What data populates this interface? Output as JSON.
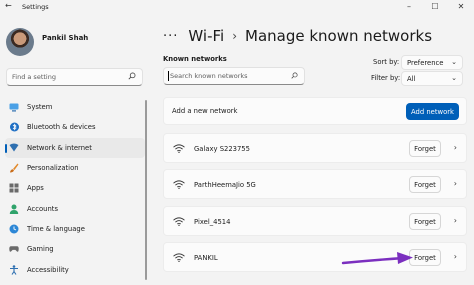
{
  "window": {
    "title": "Settings"
  },
  "user": {
    "name": "Pankil Shah"
  },
  "search": {
    "placeholder": "Find a setting"
  },
  "sidebar": {
    "items": [
      {
        "label": "System",
        "icon": "system-icon"
      },
      {
        "label": "Bluetooth & devices",
        "icon": "bluetooth-icon"
      },
      {
        "label": "Network & internet",
        "icon": "wifi-icon",
        "selected": true
      },
      {
        "label": "Personalization",
        "icon": "paintbrush-icon"
      },
      {
        "label": "Apps",
        "icon": "apps-icon"
      },
      {
        "label": "Accounts",
        "icon": "account-icon"
      },
      {
        "label": "Time & language",
        "icon": "globe-clock-icon"
      },
      {
        "label": "Gaming",
        "icon": "gamepad-icon"
      },
      {
        "label": "Accessibility",
        "icon": "accessibility-icon"
      }
    ]
  },
  "breadcrumb": {
    "more": "···",
    "parent": "Wi-Fi",
    "sep": "›",
    "current": "Manage known networks"
  },
  "known": {
    "label": "Known networks",
    "search_placeholder": "Search known networks",
    "sort_label": "Sort by:",
    "sort_value": "Preference",
    "filter_label": "Filter by:",
    "filter_value": "All"
  },
  "add_network": {
    "label": "Add a new network",
    "button": "Add network"
  },
  "networks": [
    {
      "ssid": "Galaxy S223755",
      "action": "Forget"
    },
    {
      "ssid": "ParthHeemaJio 5G",
      "action": "Forget"
    },
    {
      "ssid": "Pixel_4514",
      "action": "Forget"
    },
    {
      "ssid": "PANKIL",
      "action": "Forget"
    }
  ],
  "colors": {
    "accent": "#005fb8",
    "annotation_arrow": "#7b2fbf"
  }
}
